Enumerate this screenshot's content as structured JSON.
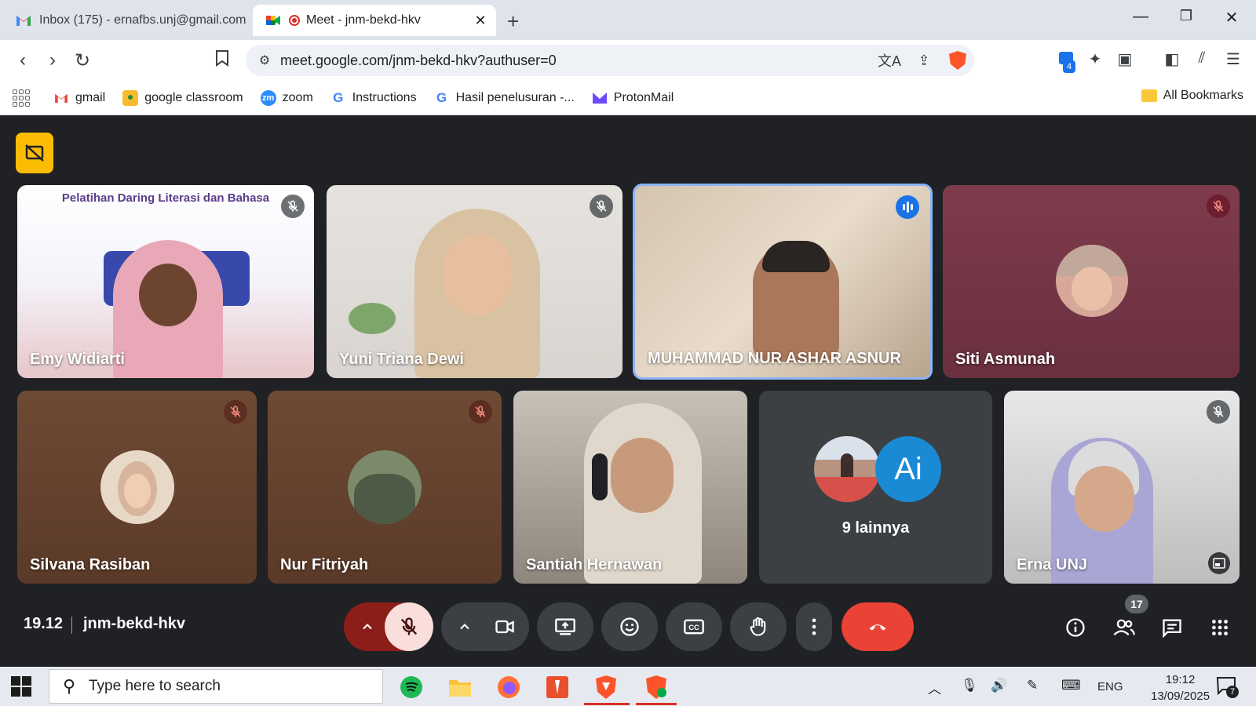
{
  "browser": {
    "tabs": [
      {
        "title": "Inbox (175) - ernafbs.unj@gmail.com",
        "icon": "gmail-icon",
        "active": false
      },
      {
        "title": "Meet - jnm-bekd-hkv",
        "icon": "meet-icon",
        "active": true
      }
    ],
    "url": "meet.google.com/jnm-bekd-hkv?authuser=0",
    "extension_badge": "4",
    "bookmarks": [
      {
        "label": "gmail",
        "icon": "gmail-icon"
      },
      {
        "label": "google classroom",
        "icon": "classroom-icon"
      },
      {
        "label": "zoom",
        "icon": "zoom-icon"
      },
      {
        "label": "Instructions",
        "icon": "google-icon"
      },
      {
        "label": "Hasil penelusuran -...",
        "icon": "google-icon"
      },
      {
        "label": "ProtonMail",
        "icon": "protonmail-icon"
      }
    ],
    "all_bookmarks": "All Bookmarks"
  },
  "meet": {
    "tiles_top": [
      {
        "name": "Emy Widiarti",
        "muted": true,
        "slide_title": "Pelatihan Daring Literasi dan Bahasa"
      },
      {
        "name": "Yuni Triana Dewi",
        "muted": true
      },
      {
        "name": "MUHAMMAD NUR ASHAR ASNUR",
        "muted": false,
        "speaking": true
      },
      {
        "name": "Siti Asmunah",
        "muted": true
      }
    ],
    "tiles_bottom": [
      {
        "name": "Silvana Rasiban",
        "muted": true
      },
      {
        "name": "Nur Fitriyah",
        "muted": true
      },
      {
        "name": "Santiah Hernawan",
        "muted": false
      },
      {
        "name": "9 lainnya",
        "avatar_text": "Ai"
      },
      {
        "name": "Erna UNJ",
        "muted": true
      }
    ],
    "time": "19.12",
    "meeting_code": "jnm-bekd-hkv",
    "participant_count": "17"
  },
  "taskbar": {
    "search_placeholder": "Type here to search",
    "language": "ENG",
    "clock_time": "19:12",
    "clock_date": "13/09/2025",
    "notification_count": "7"
  },
  "colors": {
    "meet_bg": "#202124",
    "tile_bg": "#3c4043",
    "end_call": "#ea4335",
    "mic_off_bg": "#f9dedc",
    "accent": "#8ab4f8"
  }
}
